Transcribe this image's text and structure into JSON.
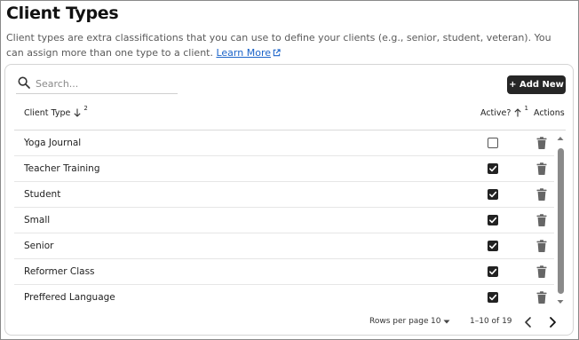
{
  "page": {
    "title": "Client Types",
    "description": "Client types are extra classifications that you can use to define your clients (e.g., senior, student, veteran). You can assign more than one type to a client.",
    "learn_more": "Learn More"
  },
  "toolbar": {
    "search_placeholder": "Search...",
    "add_label": "+ Add New"
  },
  "table": {
    "columns": {
      "client_type": {
        "label": "Client Type",
        "sort": "desc",
        "sort_order": "2"
      },
      "active": {
        "label": "Active?",
        "sort": "asc",
        "sort_order": "1"
      },
      "actions": {
        "label": "Actions"
      }
    },
    "rows": [
      {
        "name": "Yoga Journal",
        "active": false
      },
      {
        "name": "Teacher Training",
        "active": true
      },
      {
        "name": "Student",
        "active": true
      },
      {
        "name": "Small",
        "active": true
      },
      {
        "name": "Senior",
        "active": true
      },
      {
        "name": "Reformer Class",
        "active": true
      },
      {
        "name": "Preffered Language",
        "active": true
      }
    ]
  },
  "pagination": {
    "rows_per_page_label": "Rows per page",
    "rows_per_page_value": "10",
    "range": "1–10 of 19"
  },
  "icons": {
    "search": "search-icon",
    "external_link": "external-link-icon",
    "sort_desc": "arrow-down-icon",
    "sort_asc": "arrow-up-icon",
    "checkbox_checked": "checkbox-checked-icon",
    "checkbox_unchecked": "checkbox-unchecked-icon",
    "delete": "trash-icon",
    "prev_page": "chevron-left-icon",
    "next_page": "chevron-right-icon"
  },
  "colors": {
    "link": "#1a63c9",
    "primary_button": "#262626",
    "checkbox": "#222222",
    "icon": "#666666"
  }
}
